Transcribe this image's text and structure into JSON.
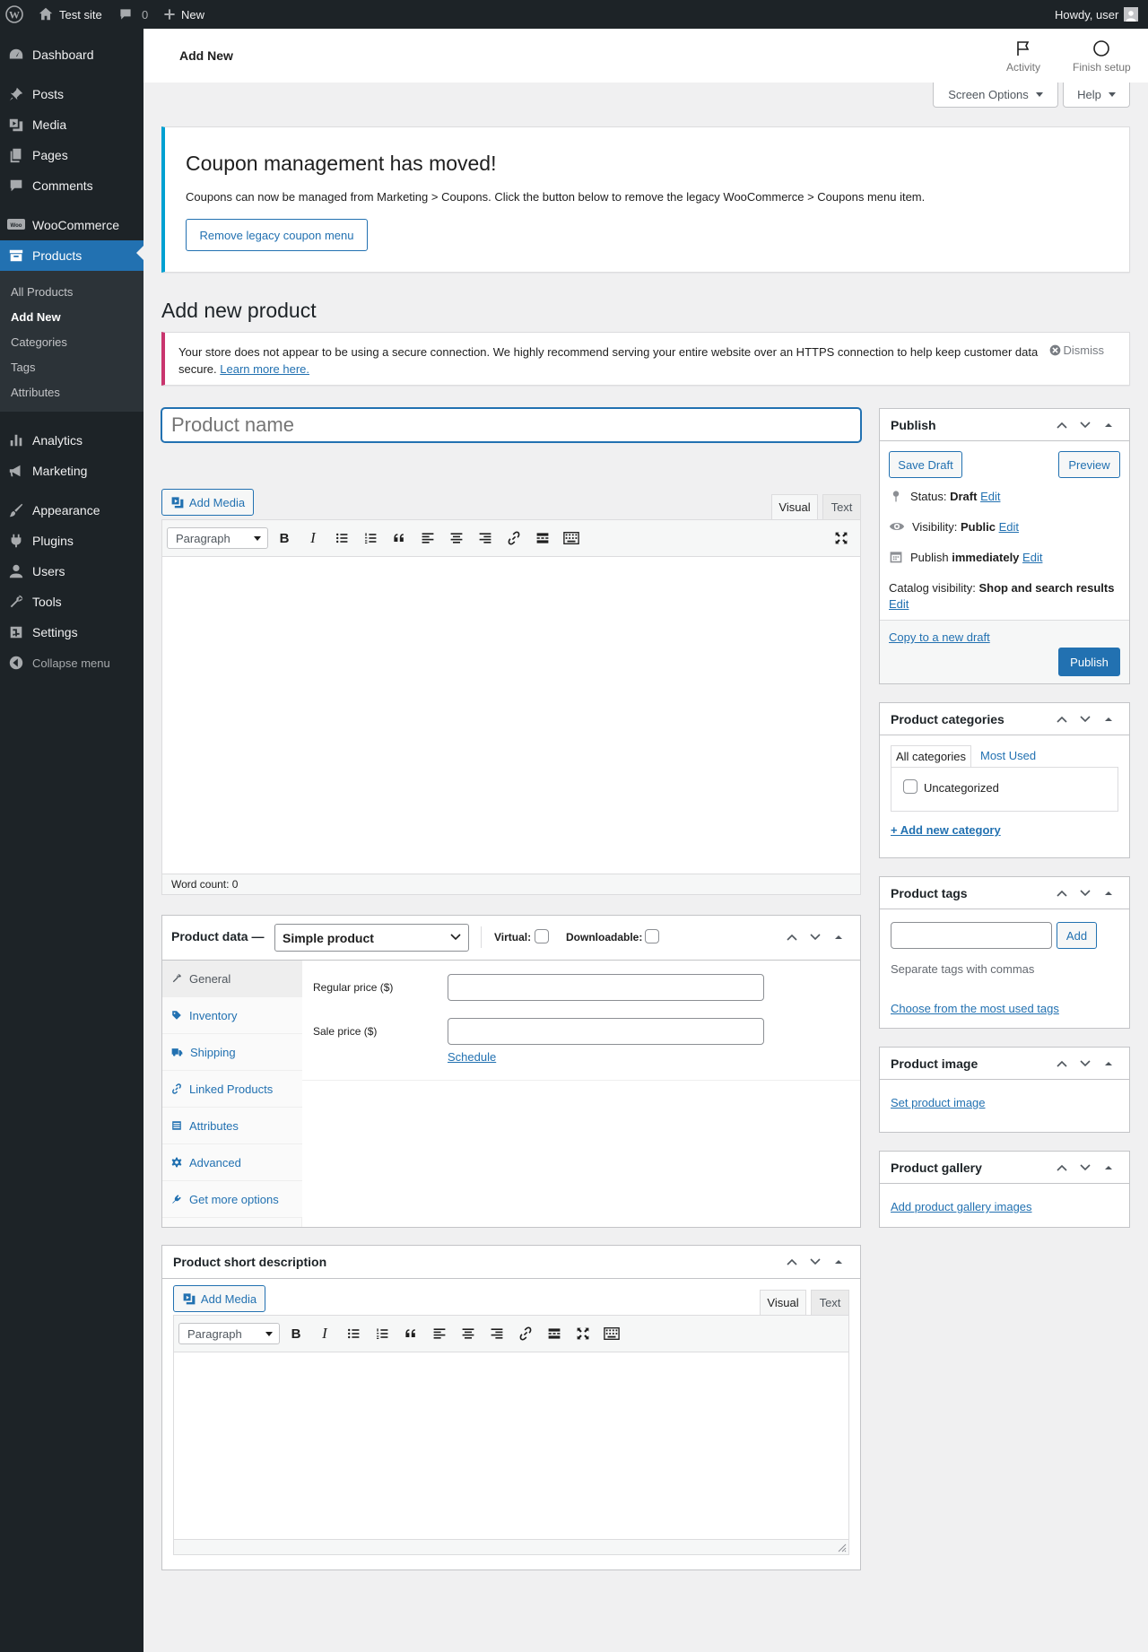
{
  "adminbar": {
    "site_name": "Test site",
    "comments_count": "0",
    "new_label": "New",
    "howdy": "Howdy, user"
  },
  "sidebar": {
    "items": [
      {
        "label": "Dashboard",
        "icon": "dashboard-icon"
      },
      {
        "label": "Posts",
        "icon": "pin-icon"
      },
      {
        "label": "Media",
        "icon": "media-icon"
      },
      {
        "label": "Pages",
        "icon": "page-icon"
      },
      {
        "label": "Comments",
        "icon": "comment-icon"
      },
      {
        "label": "WooCommerce",
        "icon": "woo-icon"
      },
      {
        "label": "Products",
        "icon": "archive-icon"
      },
      {
        "label": "Analytics",
        "icon": "bar-chart-icon"
      },
      {
        "label": "Marketing",
        "icon": "megaphone-icon"
      },
      {
        "label": "Appearance",
        "icon": "brush-icon"
      },
      {
        "label": "Plugins",
        "icon": "plug-icon"
      },
      {
        "label": "Users",
        "icon": "user-icon"
      },
      {
        "label": "Tools",
        "icon": "wrench-icon"
      },
      {
        "label": "Settings",
        "icon": "settings-icon"
      },
      {
        "label": "Collapse menu",
        "icon": "collapse-icon"
      }
    ],
    "submenu": [
      "All Products",
      "Add New",
      "Categories",
      "Tags",
      "Attributes"
    ]
  },
  "header": {
    "title": "Add New",
    "activity": "Activity",
    "finish_setup": "Finish setup"
  },
  "screen_options": "Screen Options",
  "help": "Help",
  "coupon_notice": {
    "title": "Coupon management has moved!",
    "text": "Coupons can now be managed from Marketing > Coupons. Click the button below to remove the legacy WooCommerce > Coupons menu item.",
    "button": "Remove legacy coupon menu"
  },
  "page_title": "Add new product",
  "https_notice": {
    "text": "Your store does not appear to be using a secure connection. We highly recommend serving your entire website over an HTTPS connection to help keep customer data secure.",
    "link": "Learn more here.",
    "dismiss": "Dismiss"
  },
  "product_name_placeholder": "Product name",
  "editor": {
    "add_media": "Add Media",
    "tab_visual": "Visual",
    "tab_text": "Text",
    "format": "Paragraph",
    "word_count": "Word count: 0"
  },
  "product_data": {
    "title": "Product data —",
    "type": "Simple product",
    "virtual_label": "Virtual:",
    "downloadable_label": "Downloadable:",
    "tabs": [
      "General",
      "Inventory",
      "Shipping",
      "Linked Products",
      "Attributes",
      "Advanced",
      "Get more options"
    ],
    "regular_price_label": "Regular price ($)",
    "sale_price_label": "Sale price ($)",
    "schedule": "Schedule"
  },
  "short_description": {
    "title": "Product short description",
    "add_media": "Add Media",
    "tab_visual": "Visual",
    "tab_text": "Text",
    "format": "Paragraph"
  },
  "publish": {
    "title": "Publish",
    "save_draft": "Save Draft",
    "preview": "Preview",
    "status_label": "Status:",
    "status_value": "Draft",
    "visibility_label": "Visibility:",
    "visibility_value": "Public",
    "publish_label": "Publish",
    "publish_value": "immediately",
    "catalog_label": "Catalog visibility:",
    "catalog_value": "Shop and search results",
    "edit": "Edit",
    "copy_draft": "Copy to a new draft",
    "publish_button": "Publish"
  },
  "categories": {
    "title": "Product categories",
    "tab_all": "All categories",
    "tab_most": "Most Used",
    "item": "Uncategorized",
    "add_new": "+ Add new category"
  },
  "tags": {
    "title": "Product tags",
    "add": "Add",
    "hint": "Separate tags with commas",
    "choose": "Choose from the most used tags"
  },
  "image": {
    "title": "Product image",
    "set": "Set product image"
  },
  "gallery": {
    "title": "Product gallery",
    "add": "Add product gallery images"
  },
  "colors": {
    "accent": "#2271b1",
    "sidebar": "#1d2327",
    "coupon_border": "#00a0d2",
    "notice_border": "#c9356e"
  }
}
